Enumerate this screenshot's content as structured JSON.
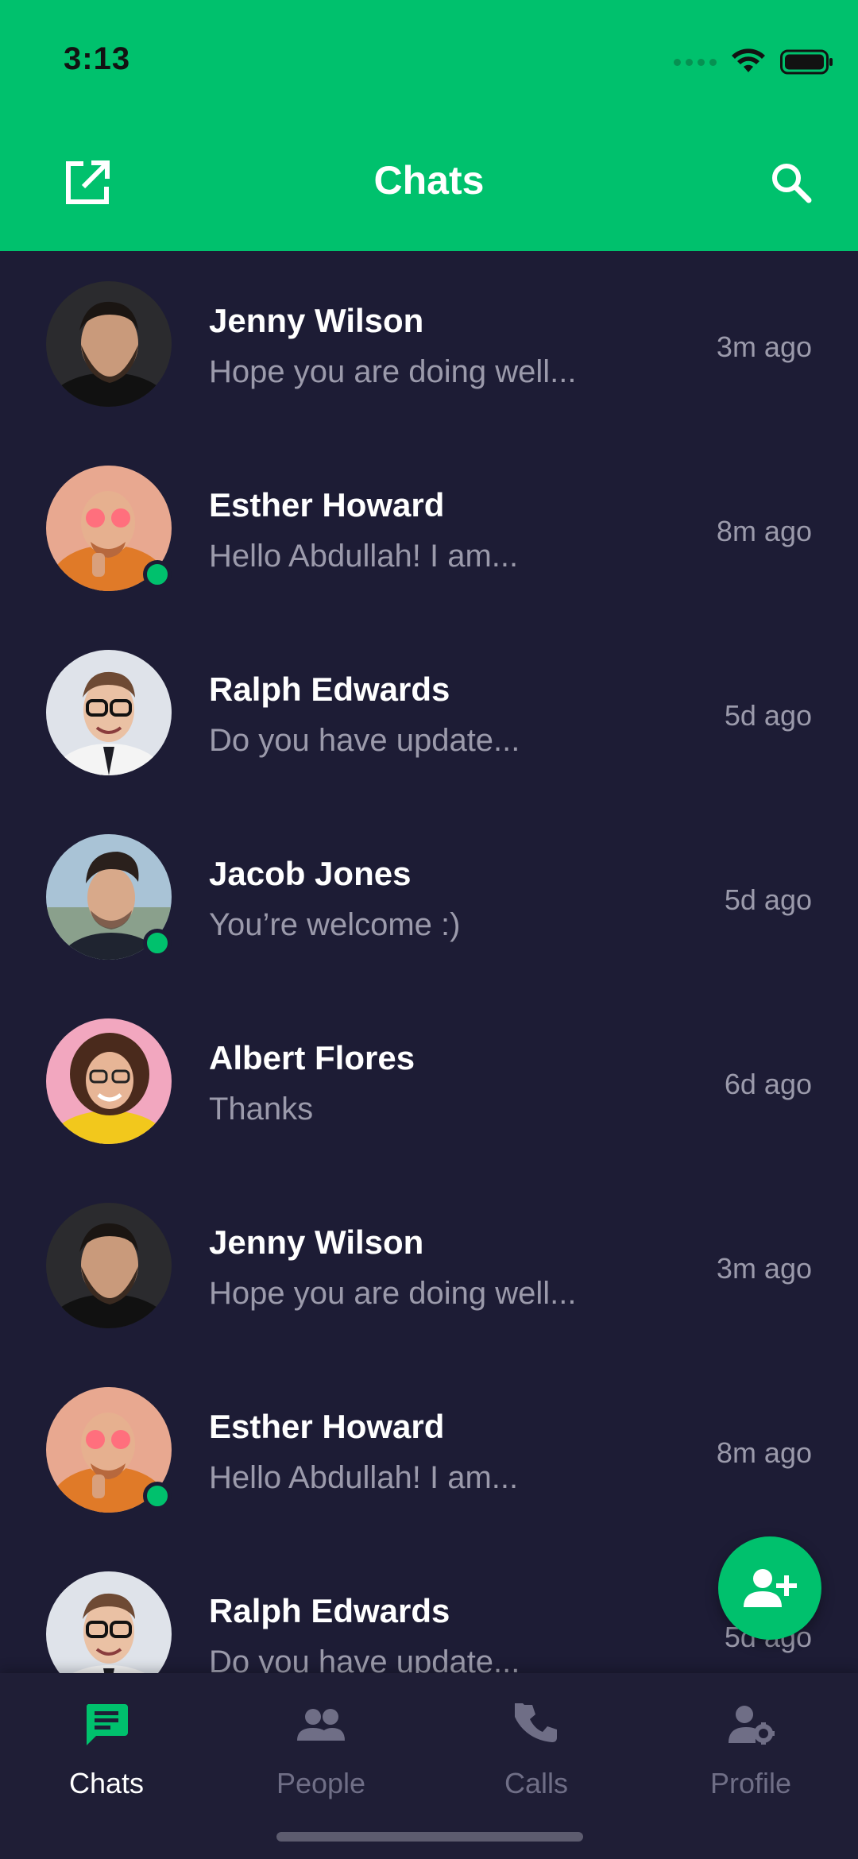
{
  "status_bar": {
    "time": "3:13"
  },
  "header": {
    "title": "Chats",
    "left_icon": "external-link-icon",
    "right_icon": "search-icon",
    "color": "#00c16d"
  },
  "chats": [
    {
      "name": "Jenny Wilson",
      "message": "Hope you are doing well...",
      "time": "3m ago",
      "online": false,
      "avatar": "avatar-bearded-man"
    },
    {
      "name": "Esther Howard",
      "message": "Hello Abdullah! I am...",
      "time": "8m ago",
      "online": true,
      "avatar": "avatar-pink-glasses-man"
    },
    {
      "name": "Ralph Edwards",
      "message": "Do you have update...",
      "time": "5d ago",
      "online": false,
      "avatar": "avatar-glasses-man"
    },
    {
      "name": "Jacob Jones",
      "message": "You’re welcome :)",
      "time": "5d ago",
      "online": true,
      "avatar": "avatar-young-man"
    },
    {
      "name": "Albert Flores",
      "message": "Thanks",
      "time": "6d ago",
      "online": false,
      "avatar": "avatar-curly-woman"
    },
    {
      "name": "Jenny Wilson",
      "message": "Hope you are doing well...",
      "time": "3m ago",
      "online": false,
      "avatar": "avatar-bearded-man"
    },
    {
      "name": "Esther Howard",
      "message": "Hello Abdullah! I am...",
      "time": "8m ago",
      "online": true,
      "avatar": "avatar-pink-glasses-man"
    },
    {
      "name": "Ralph Edwards",
      "message": "Do you have update...",
      "time": "5d ago",
      "online": false,
      "avatar": "avatar-glasses-man"
    }
  ],
  "fab": {
    "icon": "add-person-icon"
  },
  "tabs": [
    {
      "label": "Chats",
      "icon": "chat-icon",
      "active": true
    },
    {
      "label": "People",
      "icon": "people-icon",
      "active": false
    },
    {
      "label": "Calls",
      "icon": "phone-icon",
      "active": false
    },
    {
      "label": "Profile",
      "icon": "profile-settings-icon",
      "active": false
    }
  ],
  "colors": {
    "accent": "#00c16d",
    "background": "#1d1c35",
    "text_secondary": "#9b9aab",
    "tab_inactive": "#6f6e86"
  }
}
